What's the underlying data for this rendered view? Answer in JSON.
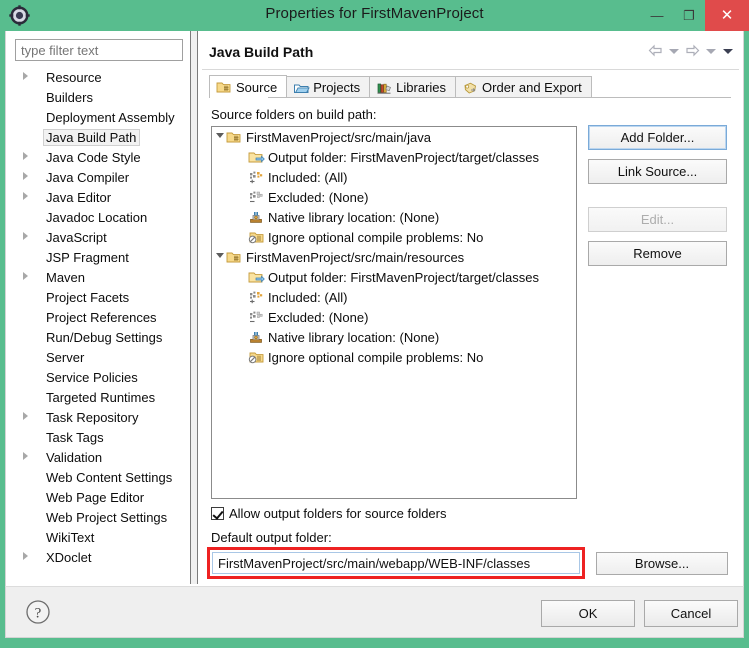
{
  "window": {
    "title": "Properties for FirstMavenProject",
    "app_icon": "gear-icon",
    "minimize_label": "—",
    "maximize_label": "❐",
    "close_label": "✕",
    "frame_color": "#58bd8e",
    "close_button_color": "#e04b4b"
  },
  "sidebar": {
    "filter_placeholder": "type filter text",
    "filter_value": "",
    "selected": "Java Build Path",
    "items": [
      {
        "label": "Resource",
        "expandable": true
      },
      {
        "label": "Builders",
        "expandable": false
      },
      {
        "label": "Deployment Assembly",
        "expandable": false
      },
      {
        "label": "Java Build Path",
        "expandable": false,
        "selected": true
      },
      {
        "label": "Java Code Style",
        "expandable": true
      },
      {
        "label": "Java Compiler",
        "expandable": true
      },
      {
        "label": "Java Editor",
        "expandable": true
      },
      {
        "label": "Javadoc Location",
        "expandable": false
      },
      {
        "label": "JavaScript",
        "expandable": true
      },
      {
        "label": "JSP Fragment",
        "expandable": false
      },
      {
        "label": "Maven",
        "expandable": true
      },
      {
        "label": "Project Facets",
        "expandable": false
      },
      {
        "label": "Project References",
        "expandable": false
      },
      {
        "label": "Run/Debug Settings",
        "expandable": false
      },
      {
        "label": "Server",
        "expandable": false
      },
      {
        "label": "Service Policies",
        "expandable": false
      },
      {
        "label": "Targeted Runtimes",
        "expandable": false
      },
      {
        "label": "Task Repository",
        "expandable": true
      },
      {
        "label": "Task Tags",
        "expandable": false
      },
      {
        "label": "Validation",
        "expandable": true
      },
      {
        "label": "Web Content Settings",
        "expandable": false
      },
      {
        "label": "Web Page Editor",
        "expandable": false
      },
      {
        "label": "Web Project Settings",
        "expandable": false
      },
      {
        "label": "WikiText",
        "expandable": false
      },
      {
        "label": "XDoclet",
        "expandable": true
      }
    ]
  },
  "main": {
    "page_title": "Java Build Path",
    "nav": {
      "back_icon": "back-arrow-icon",
      "back_menu_icon": "chevron-down-icon",
      "forward_icon": "forward-arrow-icon",
      "forward_menu_icon": "chevron-down-icon",
      "overflow_icon": "chevron-down-icon"
    },
    "tabs": [
      {
        "label": "Source",
        "icon": "source-folder-icon",
        "active": true
      },
      {
        "label": "Projects",
        "icon": "projects-icon",
        "active": false
      },
      {
        "label": "Libraries",
        "icon": "libraries-icon",
        "active": false
      },
      {
        "label": "Order and Export",
        "icon": "order-export-icon",
        "active": false
      }
    ],
    "source_label": "Source folders on build path:",
    "source_tree": [
      {
        "label": "FirstMavenProject/src/main/java",
        "icon": "source-folder-icon",
        "expanded": true,
        "children": [
          {
            "label": "Output folder: FirstMavenProject/target/classes",
            "icon": "output-folder-icon"
          },
          {
            "label": "Included: (All)",
            "icon": "included-filter-icon"
          },
          {
            "label": "Excluded: (None)",
            "icon": "excluded-filter-icon"
          },
          {
            "label": "Native library location: (None)",
            "icon": "native-library-icon"
          },
          {
            "label": "Ignore optional compile problems: No",
            "icon": "ignore-problems-icon"
          }
        ]
      },
      {
        "label": "FirstMavenProject/src/main/resources",
        "icon": "source-folder-icon",
        "expanded": true,
        "children": [
          {
            "label": "Output folder: FirstMavenProject/target/classes",
            "icon": "output-folder-icon"
          },
          {
            "label": "Included: (All)",
            "icon": "included-filter-icon"
          },
          {
            "label": "Excluded: (None)",
            "icon": "excluded-filter-icon"
          },
          {
            "label": "Native library location: (None)",
            "icon": "native-library-icon"
          },
          {
            "label": "Ignore optional compile problems: No",
            "icon": "ignore-problems-icon"
          }
        ]
      }
    ],
    "buttons": {
      "add_folder": "Add Folder...",
      "link_source": "Link Source...",
      "edit": "Edit...",
      "edit_disabled": true,
      "remove": "Remove",
      "browse": "Browse..."
    },
    "allow_output_folders": {
      "label": "Allow output folders for source folders",
      "checked": true
    },
    "default_output": {
      "label": "Default output folder:",
      "value": "FirstMavenProject/src/main/webapp/WEB-INF/classes",
      "highlight_color": "#ee2222"
    }
  },
  "footer": {
    "help_icon": "help-question-icon",
    "ok_label": "OK",
    "cancel_label": "Cancel"
  }
}
